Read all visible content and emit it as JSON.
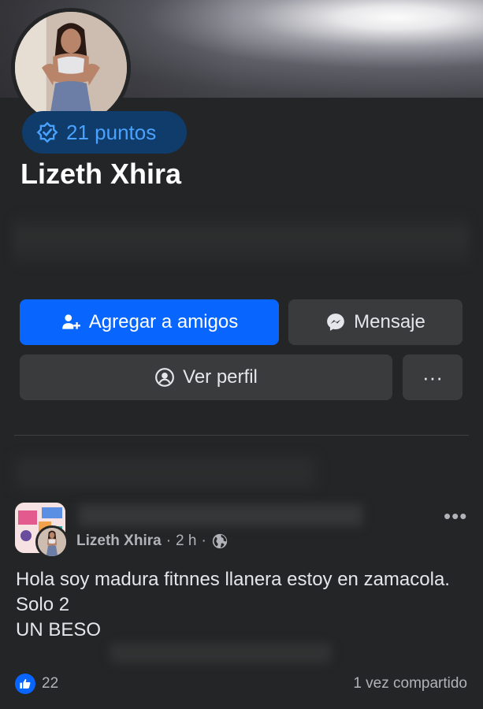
{
  "profile": {
    "name": "Lizeth Xhira",
    "points_label": "21 puntos"
  },
  "actions": {
    "add_friend": "Agregar a amigos",
    "message": "Mensaje",
    "view_profile": "Ver perfil",
    "more": "···"
  },
  "post": {
    "author": "Lizeth Xhira",
    "time": "2 h",
    "separator": "·",
    "text_lines": [
      "Hola soy madura fitnnes llanera estoy en zamacola.",
      "Solo 2",
      "UN BESO"
    ],
    "more": "•••",
    "reaction_count": "22",
    "shares": "1 vez compartido"
  },
  "colors": {
    "accent": "#0866ff",
    "points_bg": "#0f3c6b",
    "points_text": "#4aa2ff",
    "background": "#242526",
    "button_bg": "#3a3b3c"
  },
  "icons": {
    "points": "badge-check-icon",
    "add_friend": "person-add-icon",
    "message": "messenger-icon",
    "view_profile": "user-circle-icon",
    "privacy": "globe-icon",
    "like": "thumbs-up-icon"
  }
}
